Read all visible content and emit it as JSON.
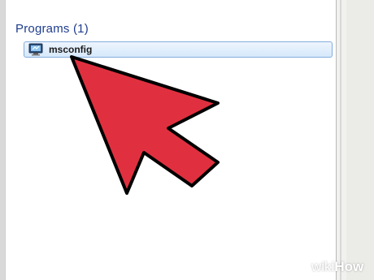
{
  "start_menu": {
    "group_header": "Programs (1)",
    "results": [
      {
        "label": "msconfig",
        "icon": "system-configuration-icon"
      }
    ]
  },
  "overlay": {
    "arrow_color": "#e0303f",
    "arrow_icon": "pointer-arrow-icon"
  },
  "watermark": {
    "wiki": "wiki",
    "how": "How"
  }
}
